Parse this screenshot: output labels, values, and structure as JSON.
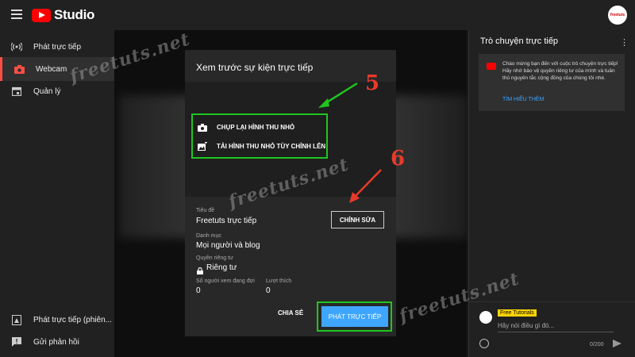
{
  "header": {
    "logo_text": "Studio",
    "avatar_text": "freetuts"
  },
  "sidebar": {
    "items": [
      {
        "label": "Phát trực tiếp",
        "icon": "broadcast-icon"
      },
      {
        "label": "Webcam",
        "icon": "camera-icon",
        "active": true
      },
      {
        "label": "Quản lý",
        "icon": "calendar-icon"
      },
      {
        "label": "Phát trực tiếp (phiên...",
        "icon": "legacy-icon"
      },
      {
        "label": "Gửi phản hồi",
        "icon": "feedback-icon"
      }
    ]
  },
  "dialog": {
    "title": "Xem trước sự kiện trực tiếp",
    "options": [
      "CHỤP LẠI HÌNH THU NHỎ",
      "TẢI HÌNH THU NHỎ TÙY CHỈNH LÊN"
    ],
    "title_label": "Tiêu đề",
    "title_value": "Freetuts trực tiếp",
    "edit_label": "CHỈNH SỬA",
    "category_label": "Danh mục",
    "category_value": "Mọi người và blog",
    "privacy_label": "Quyền riêng tư",
    "privacy_value": "Riêng tư",
    "viewers_label": "Số người xem đang đợi",
    "viewers_value": "0",
    "likes_label": "Lượt thích",
    "likes_value": "0",
    "share_label": "CHIA SẺ",
    "live_label": "PHÁT TRỰC TIẾP"
  },
  "annotations": {
    "step_a": "5",
    "step_b": "6",
    "color": "#1fc61f",
    "arrow_color": "#e83a2a"
  },
  "chat": {
    "title": "Trò chuyện trực tiếp",
    "welcome": "Chào mừng bạn đến với cuộc trò chuyện trực tiếp! Hãy nhớ bảo vệ quyền riêng tư của mình và tuân thủ nguyên tắc cộng đồng của chúng tôi nhé.",
    "learn_more": "TÌM HIỂU THÊM",
    "username": "Free Tutorials",
    "placeholder": "Hãy nói điều gì đó...",
    "counter": "0/200"
  },
  "watermark": "freetuts.net",
  "colors": {
    "accent": "#3ea6ff",
    "brand_red": "#ff0000"
  }
}
